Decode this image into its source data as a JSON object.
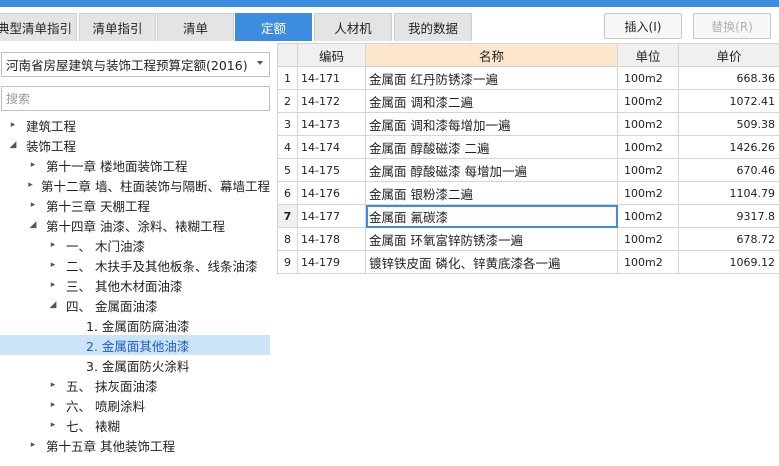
{
  "tabs": [
    {
      "label": "典型清单指引"
    },
    {
      "label": "清单指引"
    },
    {
      "label": "清单"
    },
    {
      "label": "定额"
    },
    {
      "label": "人材机"
    },
    {
      "label": "我的数据"
    }
  ],
  "buttons": {
    "insert": "插入(I)",
    "replace": "替换(R)"
  },
  "quota_select": "河南省房屋建筑与装饰工程预算定额(2016)",
  "search": {
    "placeholder": "搜索"
  },
  "tree": [
    {
      "label": "建筑工程",
      "arrow": "right"
    },
    {
      "label": "装饰工程",
      "arrow": "down"
    },
    {
      "label": "第十一章 楼地面装饰工程",
      "arrow": "right"
    },
    {
      "label": "第十二章 墙、柱面装饰与隔断、幕墙工程",
      "arrow": "right"
    },
    {
      "label": "第十三章 天棚工程",
      "arrow": "right"
    },
    {
      "label": "第十四章 油漆、涂料、裱糊工程",
      "arrow": "down"
    },
    {
      "label": "一、 木门油漆",
      "arrow": "right"
    },
    {
      "label": "二、 木扶手及其他板条、线条油漆",
      "arrow": "right"
    },
    {
      "label": "三、 其他木材面油漆",
      "arrow": "right"
    },
    {
      "label": "四、 金属面油漆",
      "arrow": "down"
    },
    {
      "label": "1. 金属面防腐油漆",
      "arrow": "none"
    },
    {
      "label": "2. 金属面其他油漆",
      "arrow": "none"
    },
    {
      "label": "3. 金属面防火涂料",
      "arrow": "none"
    },
    {
      "label": "五、 抹灰面油漆",
      "arrow": "right"
    },
    {
      "label": "六、 喷刷涂料",
      "arrow": "right"
    },
    {
      "label": "七、 裱糊",
      "arrow": "right"
    },
    {
      "label": "第十五章 其他装饰工程",
      "arrow": "right"
    }
  ],
  "table": {
    "headers": [
      "",
      "编码",
      "名称",
      "单位",
      "单价"
    ],
    "rows": [
      {
        "no": "1",
        "code": "14-171",
        "name": "金属面 红丹防锈漆一遍",
        "unit": "100m2",
        "price": "668.36"
      },
      {
        "no": "2",
        "code": "14-172",
        "name": "金属面 调和漆二遍",
        "unit": "100m2",
        "price": "1072.41"
      },
      {
        "no": "3",
        "code": "14-173",
        "name": "金属面 调和漆每增加一遍",
        "unit": "100m2",
        "price": "509.38"
      },
      {
        "no": "4",
        "code": "14-174",
        "name": "金属面 醇酸磁漆 二遍",
        "unit": "100m2",
        "price": "1426.26"
      },
      {
        "no": "5",
        "code": "14-175",
        "name": "金属面 醇酸磁漆 每增加一遍",
        "unit": "100m2",
        "price": "670.46"
      },
      {
        "no": "6",
        "code": "14-176",
        "name": "金属面 银粉漆二遍",
        "unit": "100m2",
        "price": "1104.79"
      },
      {
        "no": "7",
        "code": "14-177",
        "name": "金属面 氟碳漆",
        "unit": "100m2",
        "price": "9317.8"
      },
      {
        "no": "8",
        "code": "14-178",
        "name": "金属面 环氧富锌防锈漆一遍",
        "unit": "100m2",
        "price": "678.72"
      },
      {
        "no": "9",
        "code": "14-179",
        "name": "镀锌铁皮面 磷化、锌黄底漆各一遍",
        "unit": "100m2",
        "price": "1069.12"
      }
    ]
  },
  "colors": {
    "accent": "#3c8de0",
    "selected_bg": "#cce4f7",
    "header_highlight": "#fce6cd"
  }
}
